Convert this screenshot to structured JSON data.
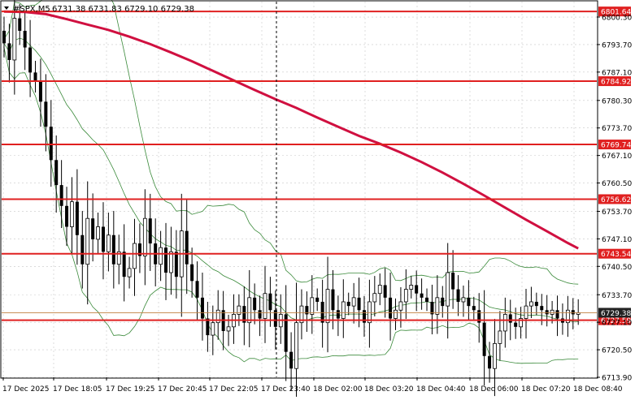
{
  "header": {
    "symbol": "#SPX,M5",
    "ohlc": "6731.38 6731.83 6729.10 6729.38"
  },
  "colors": {
    "background": "#ffffff",
    "frame": "#000000",
    "candle": "#000000",
    "bollinger": "#3a8a3a",
    "moving_average": "#d01040",
    "level_line": "#e02020",
    "level_label_bg": "#e02020",
    "grid": "#c8c8c8",
    "price_tag_bg": "#222222",
    "bid_line": "#c08040"
  },
  "chart_data": {
    "type": "candlestick",
    "y_axis_ticks": [
      "6800.30",
      "6793.70",
      "6787.10",
      "6780.30",
      "6773.70",
      "6767.10",
      "6760.50",
      "6753.70",
      "6747.10",
      "6740.50",
      "6733.70",
      "6727.10",
      "6720.50",
      "6713.90"
    ],
    "ylim": [
      6713.9,
      6804.0
    ],
    "x_axis_ticks": [
      "17 Dec 2025",
      "17 Dec 18:05",
      "17 Dec 19:25",
      "17 Dec 20:45",
      "17 Dec 22:05",
      "17 Dec 23:40",
      "18 Dec 02:00",
      "18 Dec 03:20",
      "18 Dec 04:40",
      "18 Dec 06:00",
      "18 Dec 07:20",
      "18 Dec 08:40"
    ],
    "levels": [
      "6801.64",
      "6784.92",
      "6769.74",
      "6756.62",
      "6743.54",
      "6727.59"
    ],
    "current_price": "6729.38",
    "moving_average": [
      [
        0,
        6801.6
      ],
      [
        4,
        6801.5
      ],
      [
        8,
        6801.0
      ],
      [
        12,
        6799.8
      ],
      [
        16,
        6798.5
      ],
      [
        20,
        6797.2
      ],
      [
        24,
        6795.6
      ],
      [
        28,
        6793.8
      ],
      [
        32,
        6791.8
      ],
      [
        36,
        6789.7
      ],
      [
        40,
        6787.4
      ],
      [
        44,
        6785.1
      ],
      [
        48,
        6782.8
      ],
      [
        52,
        6780.6
      ],
      [
        56,
        6778.5
      ],
      [
        60,
        6776.2
      ],
      [
        64,
        6774.0
      ],
      [
        68,
        6771.8
      ],
      [
        72,
        6769.9
      ],
      [
        76,
        6767.8
      ],
      [
        80,
        6765.5
      ],
      [
        84,
        6763.0
      ],
      [
        88,
        6760.3
      ],
      [
        92,
        6757.5
      ],
      [
        96,
        6754.6
      ],
      [
        100,
        6751.7
      ],
      [
        104,
        6748.9
      ],
      [
        108,
        6746.1
      ],
      [
        110,
        6744.8
      ]
    ],
    "candles_close": [
      6794,
      6790,
      6800,
      6797,
      6793,
      6787,
      6785,
      6780,
      6774,
      6766,
      6760,
      6755,
      6750,
      6756,
      6748,
      6741,
      6752,
      6747,
      6750,
      6744,
      6748,
      6741,
      6744,
      6738,
      6740,
      6746,
      6743,
      6752,
      6746,
      6741,
      6745,
      6739,
      6744,
      6738,
      6749,
      6741,
      6737,
      6733,
      6728,
      6724,
      6727,
      6730,
      6725,
      6726,
      6729,
      6731,
      6727,
      6733,
      6730,
      6728,
      6734,
      6730,
      6726,
      6729,
      6720,
      6716,
      6727,
      6731,
      6729,
      6733,
      6732,
      6727,
      6735,
      6730,
      6728,
      6732,
      6731,
      6733,
      6730,
      6727,
      6732,
      6734,
      6736,
      6733,
      6728,
      6730,
      6732,
      6735,
      6736,
      6734,
      6733,
      6732,
      6729,
      6733,
      6731,
      6739,
      6735,
      6732,
      6733,
      6731,
      6730,
      6727,
      6719,
      6716,
      6722,
      6725,
      6729,
      6727,
      6726,
      6728,
      6731,
      6732,
      6731,
      6730,
      6729,
      6730,
      6728,
      6727,
      6730,
      6729,
      6729.38
    ]
  }
}
